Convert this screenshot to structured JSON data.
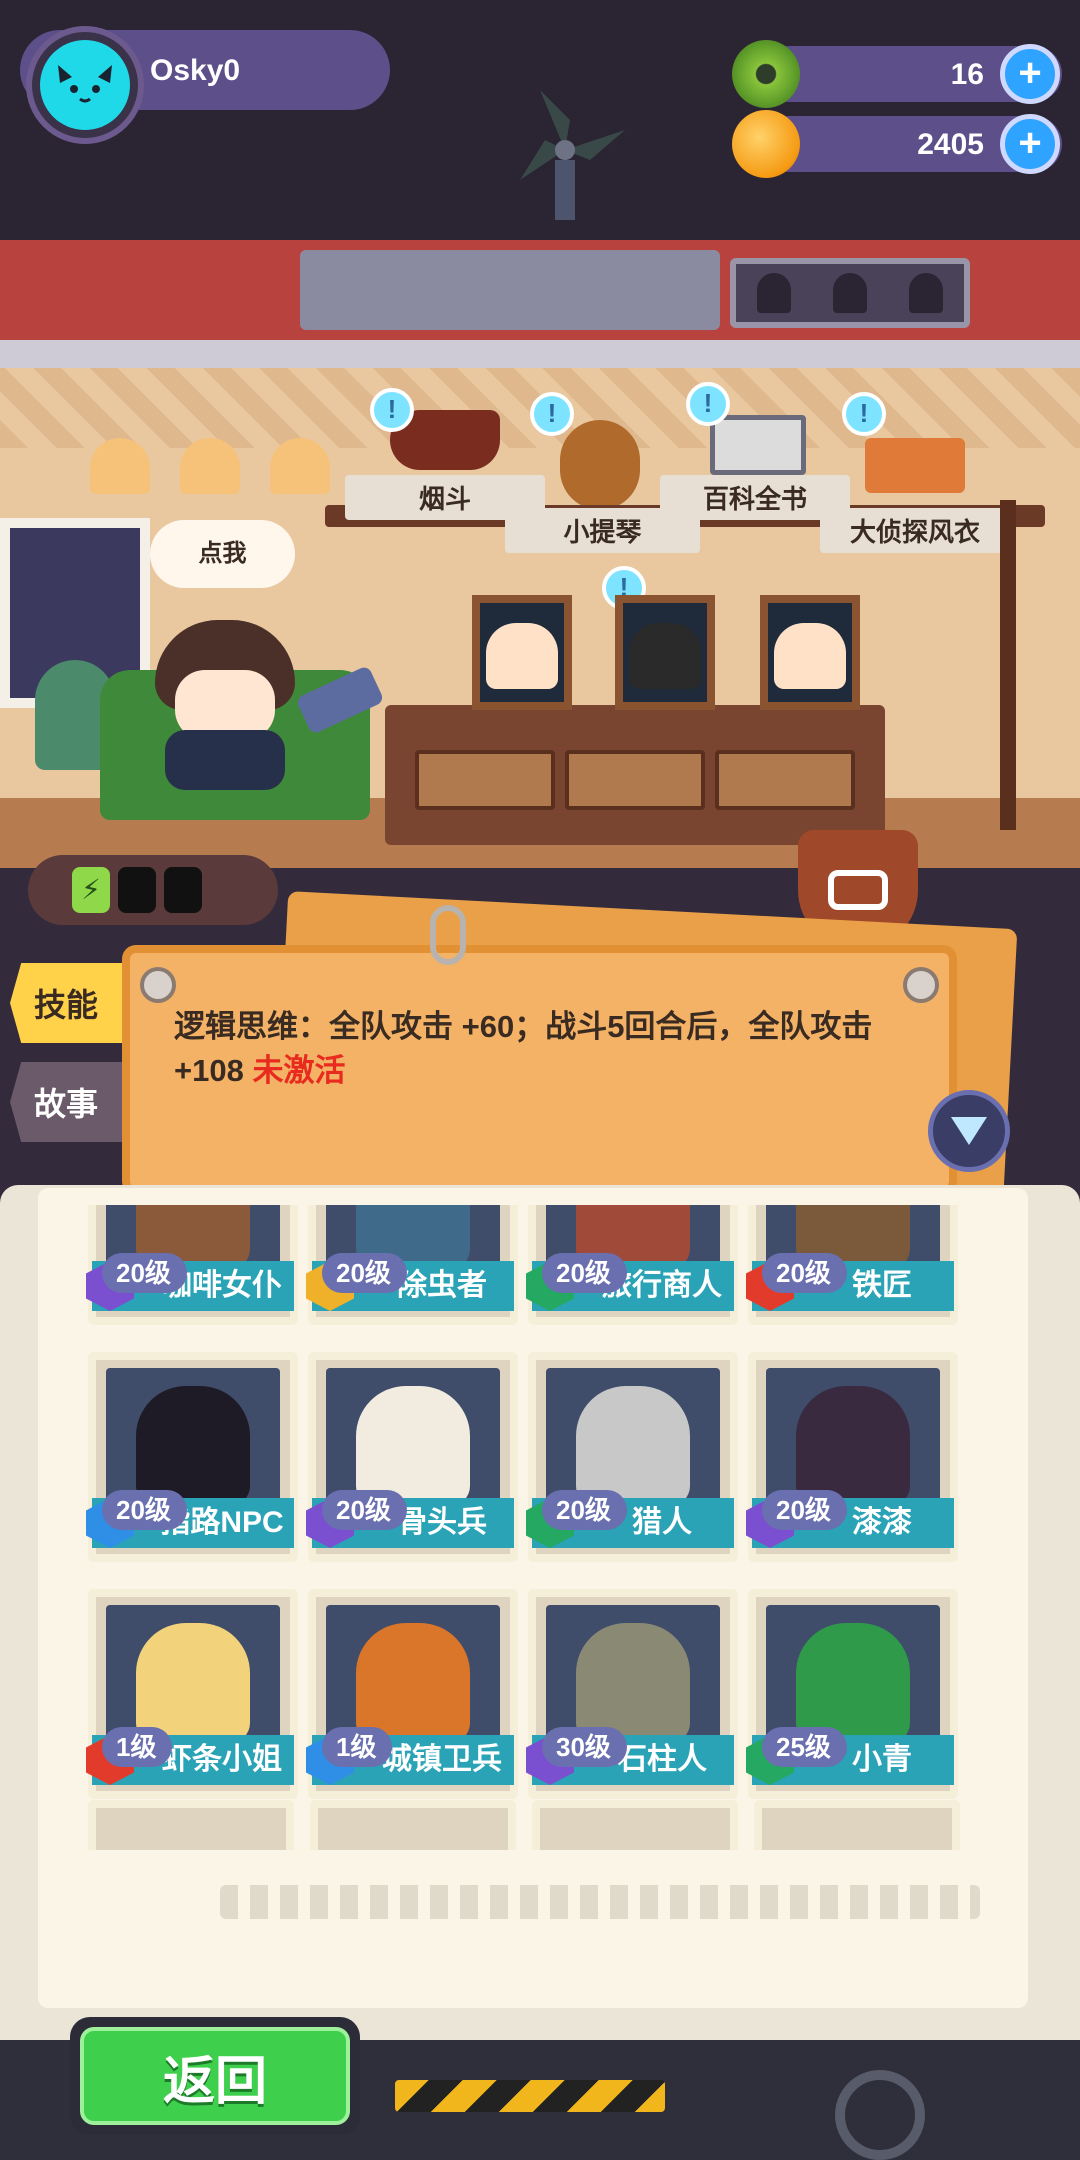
{
  "player": {
    "name": "Osky0",
    "avatar_icon": "cat-face-icon"
  },
  "currency": [
    {
      "icon": "green-donut-icon",
      "value": "16",
      "plus": "+"
    },
    {
      "icon": "gold-planet-coin-icon",
      "value": "2405",
      "plus": "+"
    }
  ],
  "room": {
    "speech_bubble": "点我",
    "items": [
      {
        "label": "烟斗",
        "icon": "pipe-icon"
      },
      {
        "label": "小提琴",
        "icon": "violin-icon"
      },
      {
        "label": "百科全书",
        "icon": "encyclopedia-icon"
      },
      {
        "label": "大侦探风衣",
        "icon": "detective-coat-icon"
      }
    ],
    "alert_glyph": "!",
    "energy": {
      "charged": 1,
      "total": 3
    }
  },
  "tabs": {
    "skill": "技能",
    "story": "故事"
  },
  "skill_note": {
    "text": "逻辑思维：全队攻击 +60；战斗5回合后，全队攻击 +108",
    "status": " 未激活"
  },
  "characters": [
    {
      "level": "20级",
      "name": "咖啡女仆",
      "rarity": "purple",
      "art_color": "#8a5a3a"
    },
    {
      "level": "20级",
      "name": "除虫者",
      "rarity": "gold",
      "art_color": "#3f6a8a"
    },
    {
      "level": "20级",
      "name": "旅行商人",
      "rarity": "green",
      "art_color": "#a04a3a"
    },
    {
      "level": "20级",
      "name": "铁匠",
      "rarity": "red",
      "art_color": "#7a5a3a"
    },
    {
      "level": "20级",
      "name": "指路NPC",
      "rarity": "blue",
      "art_color": "#1e1a26"
    },
    {
      "level": "20级",
      "name": "骨头兵",
      "rarity": "purple",
      "art_color": "#f2ece0"
    },
    {
      "level": "20级",
      "name": "猎人",
      "rarity": "green",
      "art_color": "#c8c8c8"
    },
    {
      "level": "20级",
      "name": "漆漆",
      "rarity": "purple",
      "art_color": "#3a2a40"
    },
    {
      "level": "1级",
      "name": "虾条小姐",
      "rarity": "red",
      "art_color": "#f2d27a"
    },
    {
      "level": "1级",
      "name": "城镇卫兵",
      "rarity": "blue",
      "art_color": "#d9762a"
    },
    {
      "level": "30级",
      "name": "石柱人",
      "rarity": "purple",
      "art_color": "#8a8a74"
    },
    {
      "level": "25级",
      "name": "小青",
      "rarity": "green",
      "art_color": "#2e9a4a"
    }
  ],
  "back_button": "返回"
}
